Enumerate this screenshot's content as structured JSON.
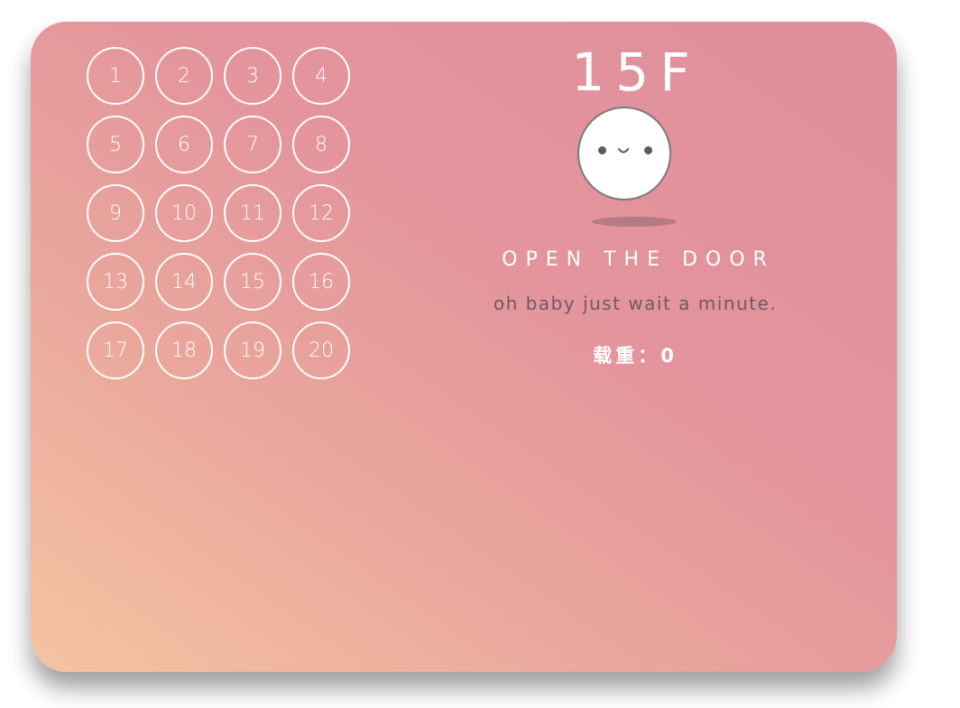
{
  "floor_buttons": [
    "1",
    "2",
    "3",
    "4",
    "5",
    "6",
    "7",
    "8",
    "9",
    "10",
    "11",
    "12",
    "13",
    "14",
    "15",
    "16",
    "17",
    "18",
    "19",
    "20"
  ],
  "display": {
    "current_floor": "15F"
  },
  "status": {
    "title": "OPEN THE DOOR",
    "subtitle": "oh baby just wait a minute.",
    "load_label": "载重：",
    "load_value": "0"
  },
  "colors": {
    "gradient_start": "#f5c3a2",
    "gradient_end": "#e08f9b",
    "button_border": "#ffffff",
    "subtitle_text": "#6f5a62"
  },
  "icons": {
    "face": "smiley-face-icon"
  }
}
